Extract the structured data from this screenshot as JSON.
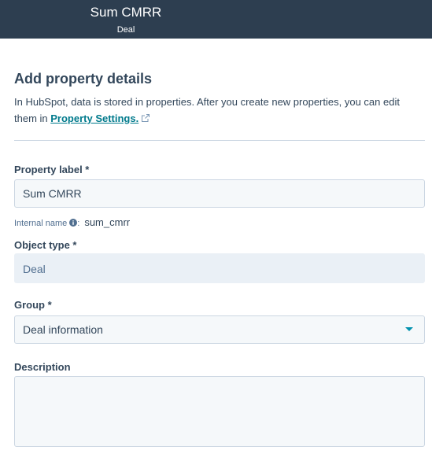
{
  "header": {
    "title": "Sum CMRR",
    "subtitle": "Deal"
  },
  "section": {
    "title": "Add property details",
    "desc_part1": "In HubSpot, data is stored in properties. After you create new properties, you can edit them in ",
    "link_text": "Property Settings.",
    "link_icon": "external-link-icon"
  },
  "fields": {
    "property_label": {
      "label": "Property label *",
      "value": "Sum CMRR"
    },
    "internal_name": {
      "label": "Internal name",
      "icon": "info-icon",
      "value": "sum_cmrr"
    },
    "object_type": {
      "label": "Object type *",
      "value": "Deal"
    },
    "group": {
      "label": "Group *",
      "value": "Deal information",
      "icon": "caret-down-icon"
    },
    "description": {
      "label": "Description",
      "value": ""
    }
  },
  "colors": {
    "header_bg": "#2d3e50",
    "link": "#007a8c",
    "accent": "#0091ae"
  }
}
